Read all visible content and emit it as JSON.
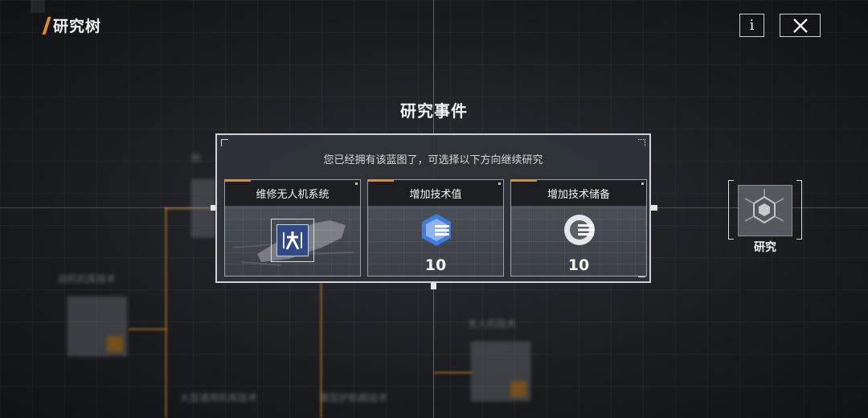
{
  "header": {
    "title": "研究树"
  },
  "buttons": {
    "info_label": "i"
  },
  "background_nodes": [
    {
      "label": "",
      "visible_text": "附"
    },
    {
      "label": "战机机库技术"
    },
    {
      "label": "无人机技术"
    },
    {
      "label": "大型通用机库技术"
    },
    {
      "label": "重型护航舰技术"
    }
  ],
  "modal": {
    "title": "研究事件",
    "subtitle": "您已经拥有该蓝图了，可选择以下方向继续研究",
    "options": [
      {
        "label": "维修无人机系统",
        "value": "",
        "icon": "repair-drone-blueprint-icon"
      },
      {
        "label": "增加技术值",
        "value": "10",
        "icon": "tech-value-icon"
      },
      {
        "label": "增加技术储备",
        "value": "10",
        "icon": "tech-reserve-icon"
      }
    ]
  },
  "right_node": {
    "label": "研究",
    "icon": "research-hexagon-icon"
  },
  "colors": {
    "accent": "#e08a1e",
    "blue_icon": "#3f7be0",
    "panel_border": "#cfd2d6"
  }
}
